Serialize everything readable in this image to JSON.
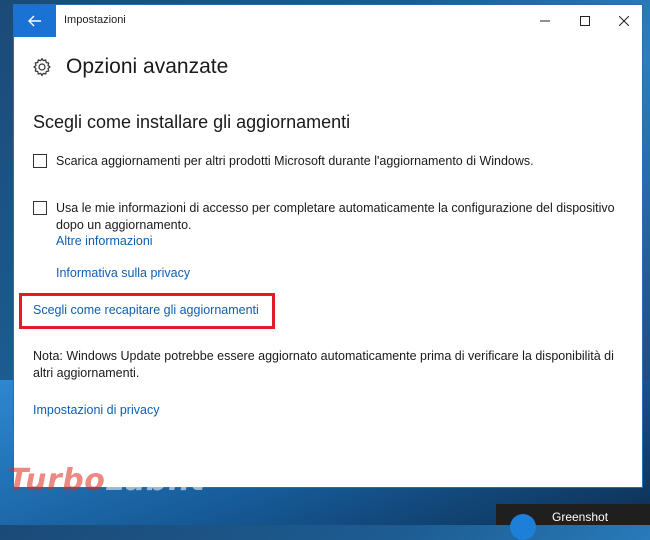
{
  "window": {
    "title": "Impostazioni",
    "controls": {
      "minimize": "—",
      "maximize": "☐",
      "close": "✕"
    }
  },
  "page": {
    "title": "Opzioni avanzate",
    "section_title": "Scegli come installare gli aggiornamenti"
  },
  "options": [
    {
      "text": "Scarica aggiornamenti per altri prodotti Microsoft durante l'aggiornamento di Windows.",
      "checked": false
    },
    {
      "text": "Usa le mie informazioni di accesso per completare automaticamente la configurazione del dispositivo dopo un aggiornamento.",
      "checked": false,
      "link": "Altre informazioni"
    }
  ],
  "links": {
    "privacy_info": "Informativa sulla privacy",
    "delivery": "Scegli come recapitare gli aggiornamenti",
    "privacy_settings": "Impostazioni di privacy"
  },
  "note": "Nota: Windows Update potrebbe essere aggiornato automaticamente prima di verificare la disponibilità di altri aggiornamenti.",
  "watermark": {
    "part1": "Turbo",
    "part2": "Lab.it"
  },
  "taskbar": {
    "app_label": "Greenshot"
  },
  "colors": {
    "accent": "#1a73d4",
    "link": "#0f5fb0",
    "highlight": "#e21b24"
  }
}
